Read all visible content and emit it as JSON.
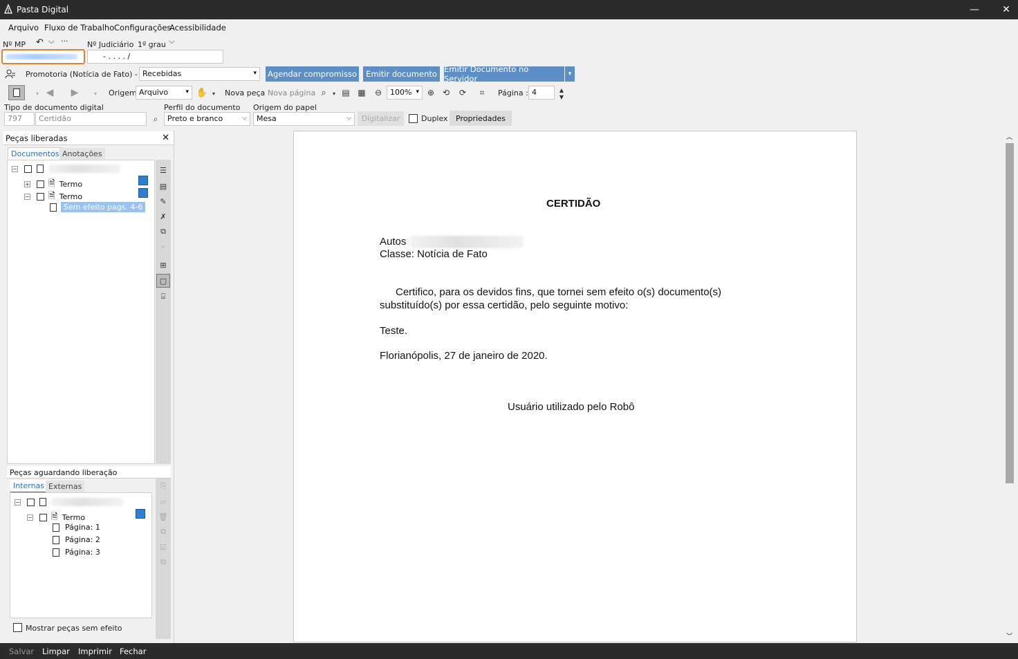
{
  "window": {
    "title": "Pasta Digital",
    "minimize": "—",
    "close": "✕"
  },
  "menu": [
    "Arquivo",
    "Fluxo de Trabalho",
    "Configurações",
    "Acessibilidade"
  ],
  "header": {
    "nmp_label": "Nº MP",
    "undo": "↶",
    "chev": "⌵",
    "more": "···",
    "judicial_label": "Nº Judiciário",
    "grau": "1º grau",
    "judicial_value": "-  .  . . .   /",
    "promotoria": "Promotoria (Notícia de Fato) - Fila",
    "fila_value": "Recebidas",
    "btn_agendar": "Agendar compromisso",
    "btn_emitir": "Emitir documento",
    "btn_emitir_servidor": "Emitir Documento no Servidor"
  },
  "toolbar": {
    "origem_label": "Origem",
    "origem_value": "Arquivo",
    "nova_peca": "Nova peça",
    "nova_pagina": "Nova página",
    "zoom": "100%",
    "pagina_label": "Página :",
    "pagina_value": "4"
  },
  "fields": {
    "tipo_label": "Tipo de documento digital",
    "tipo_code": "797",
    "tipo_value": "Certidão",
    "perfil_label": "Perfil do documento",
    "perfil_value": "Preto e branco",
    "origem_papel_label": "Origem do papel",
    "origem_papel_value": "Mesa",
    "digitalizar": "Digitalizar",
    "duplex": "Duplex",
    "propriedades": "Propriedades"
  },
  "left_top": {
    "title": "Peças liberadas",
    "tabs": [
      "Documentos",
      "Anotações"
    ],
    "items": [
      {
        "label": "Termo"
      },
      {
        "label": "Termo"
      },
      {
        "label": "Sem efeito pags. 4-6"
      }
    ]
  },
  "left_bottom": {
    "title": "Peças aguardando liberação",
    "tabs": [
      "Internas",
      "Externas"
    ],
    "items": [
      {
        "label": "Termo"
      },
      {
        "label": "Página: 1"
      },
      {
        "label": "Página: 2"
      },
      {
        "label": "Página: 3"
      }
    ],
    "mostrar": "Mostrar peças sem efeito"
  },
  "document": {
    "title": "CERTIDÃO",
    "autos": "Autos",
    "classe": "Classe: Notícia de Fato",
    "p1": "Certifico, para os devidos fins, que tornei sem efeito o(s) documento(s)",
    "p2": "substituído(s) por essa certidão, pelo seguinte motivo:",
    "motivo": "Teste.",
    "local_data": "Florianópolis, 27 de janeiro de 2020.",
    "assinatura": "Usuário utilizado pelo Robô"
  },
  "status": [
    "Salvar",
    "Limpar",
    "Imprimir",
    "Fechar"
  ]
}
